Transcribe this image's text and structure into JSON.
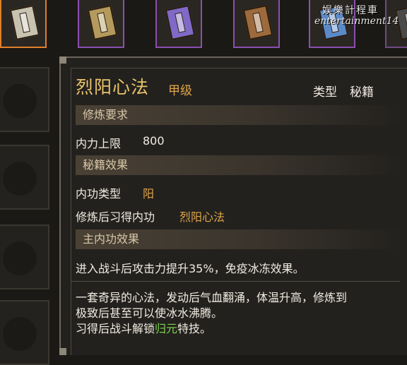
{
  "inventory": {
    "slots": [
      {
        "name": "book-slot-1",
        "color": "#c8c2b0"
      },
      {
        "name": "book-slot-2",
        "color": "#b49a5c"
      },
      {
        "name": "book-slot-3",
        "color": "#7f6ac8"
      },
      {
        "name": "book-slot-4",
        "color": "#9c6a3c"
      },
      {
        "name": "book-slot-5",
        "color": "#5a8acb"
      },
      {
        "name": "book-slot-6",
        "color": "#4a4a4a"
      }
    ]
  },
  "watermark": {
    "line1": "娱樂計程車",
    "line2": "entertainment14"
  },
  "tooltip": {
    "name": "烈阳心法",
    "grade": "甲级",
    "type_label": "类型",
    "type_value": "秘籍",
    "requirements_header": "修炼要求",
    "requirement_label": "内力上限",
    "requirement_value": "800",
    "effect_header": "秘籍效果",
    "internal_type_label": "内功类型",
    "internal_type_value": "阳",
    "learn_label": "修炼后习得内功",
    "learn_value": "烈阳心法",
    "main_effect_header": "主内功效果",
    "main_effect_text": "进入战斗后攻击力提升35%，免疫冰冻效果。",
    "description_line1": "一套奇异的心法，发动后气血翻涌，体温升高，修炼到",
    "description_line2": "极致后甚至可以使冰水沸腾。",
    "description_line3_prefix": "习得后战斗解锁",
    "description_line3_highlight": "归元",
    "description_line3_suffix": "特技。"
  }
}
